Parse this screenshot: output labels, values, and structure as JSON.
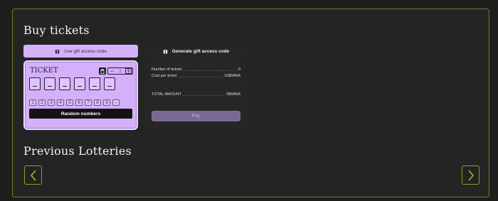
{
  "buy": {
    "title": "Buy tickets",
    "gift_tab_label": "Use gift access code",
    "generate_tab_label": "Generate gift access code"
  },
  "ticket": {
    "label": "TICKET",
    "count": "1",
    "slots": [
      "",
      "",
      "",
      "",
      "",
      ""
    ],
    "keys": [
      "1",
      "2",
      "3",
      "4",
      "5",
      "6",
      "7",
      "8",
      "9",
      "←"
    ],
    "random_label": "Random numbers"
  },
  "summary": {
    "num_label": "Number of tickets",
    "num_value": "0",
    "cost_label": "Cost per ticket",
    "cost_value": "10$MINA",
    "total_label": "TOTAL AMOUNT",
    "total_value": "0$MINA",
    "pay_label": "Pay"
  },
  "previous": {
    "title": "Previous Lotteries"
  },
  "colors": {
    "accent": "#d3b0f9",
    "border": "#6f7f23",
    "nav": "#8aa02a",
    "pay": "#7a6a93"
  },
  "icons": {
    "gift": "gift-icon",
    "trash": "trash-icon",
    "prev": "chevron-left-icon",
    "next": "chevron-right-icon"
  }
}
